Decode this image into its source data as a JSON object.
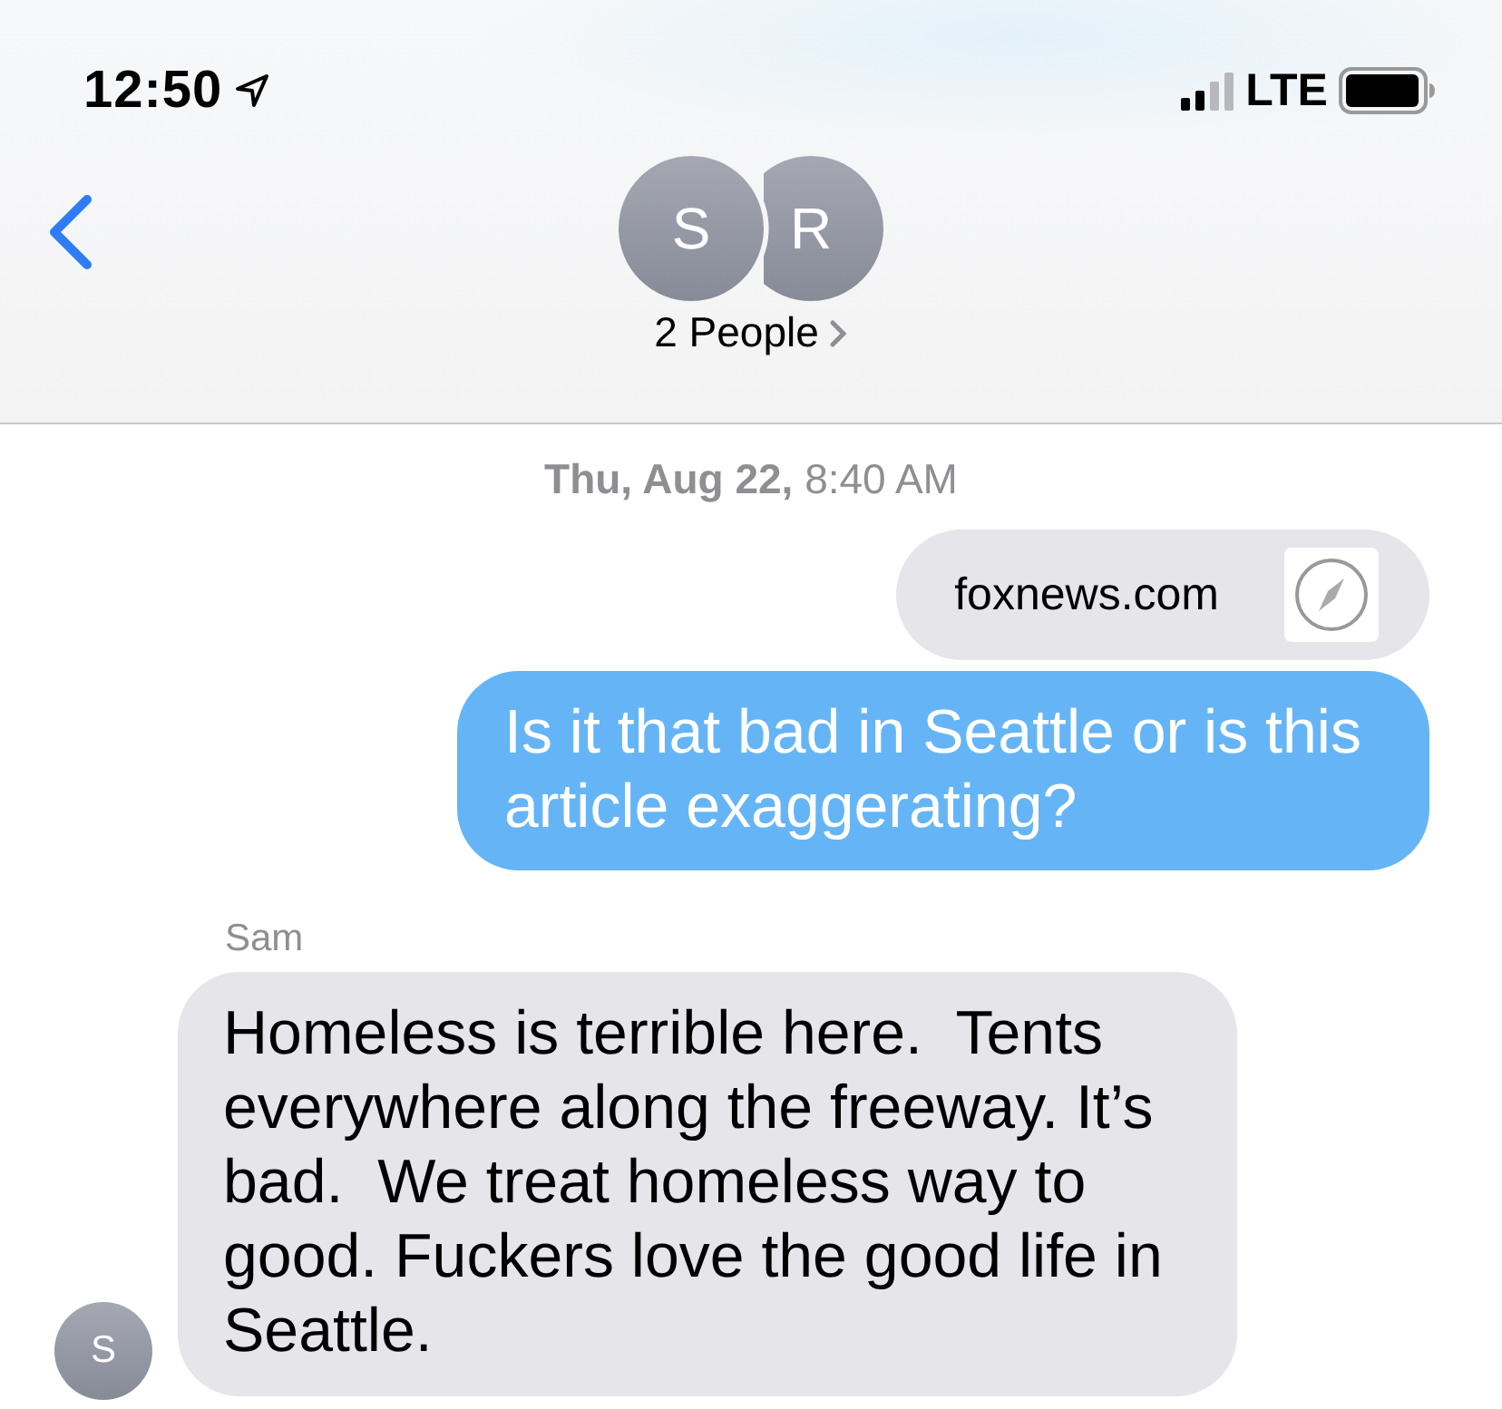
{
  "status_bar": {
    "time": "12:50",
    "network": "LTE"
  },
  "header": {
    "avatars": [
      "S",
      "R"
    ],
    "title": "2 People"
  },
  "timestamp": "**Thu, Aug 22,** 8:40 AM",
  "messages": [
    {
      "kind": "link",
      "outgoing": true,
      "url": "foxnews.com"
    },
    {
      "kind": "text",
      "outgoing": true,
      "text": "Is it that bad in Seattle or is this article exaggerating?"
    },
    {
      "kind": "text",
      "outgoing": false,
      "sender": "Sam",
      "avatar": "S",
      "text": "Homeless is terrible here.  Tents everywhere along the freeway. It’s bad.  We treat homeless way to good. Fuckers love the good life in Seattle."
    }
  ]
}
